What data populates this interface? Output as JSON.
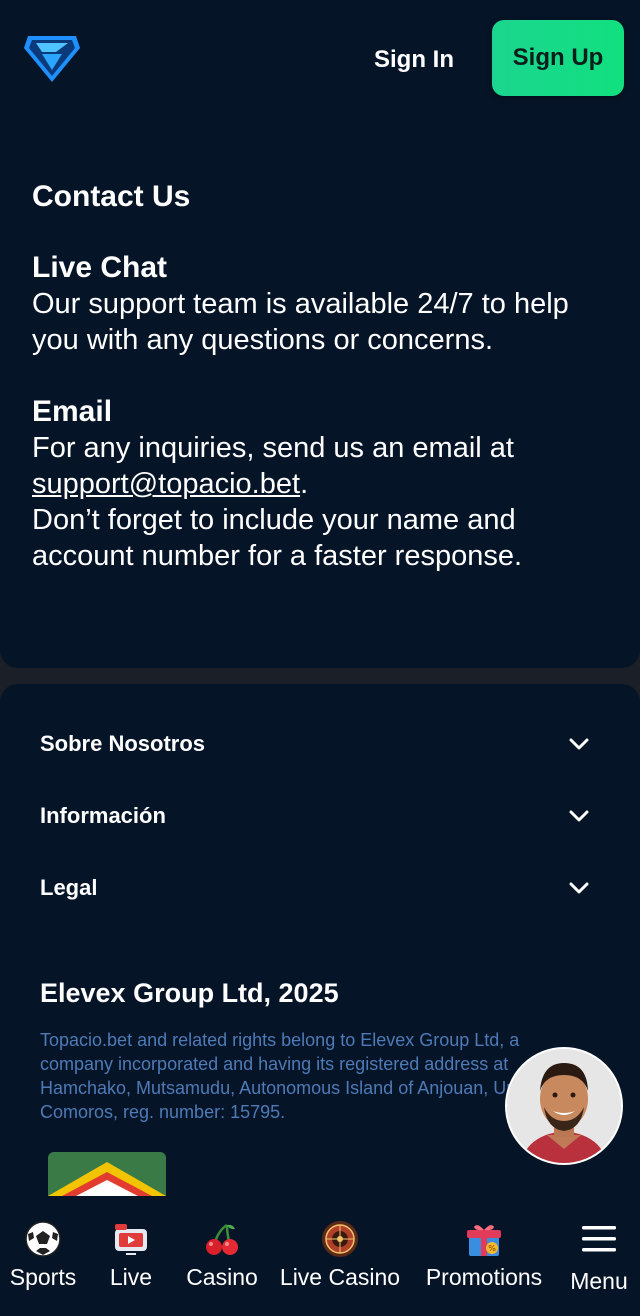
{
  "header": {
    "logo_icon": "topacio-diamond-logo",
    "signin_label": "Sign In",
    "signup_label": "Sign Up",
    "accent": "#17d98a"
  },
  "contact": {
    "title": "Contact Us",
    "live_chat_title": "Live Chat",
    "live_chat_text": "Our support team is available 24/7 to help you with any questions or concerns.",
    "email_title": "Email",
    "email_text_before": "For any inquiries, send us an email at ",
    "email_address": "support@topacio.bet",
    "email_text_after": ".",
    "email_note": "Don’t forget to include your name and account number for a faster response."
  },
  "footer": {
    "sections": [
      {
        "label": "Sobre Nosotros"
      },
      {
        "label": "Información"
      },
      {
        "label": "Legal"
      }
    ],
    "company": "Elevex Group Ltd, 2025",
    "legal_text": "Topacio.bet and related rights belong to Elevex Group Ltd, a company incorporated and having its registered address at Hamchako, Mutsamudu, Autonomous Island of Anjouan, Union of Comoros, reg. number: 15795."
  },
  "support_avatar": "support-agent-avatar",
  "bottom_nav": {
    "items": [
      {
        "label": "Sports",
        "icon": "soccer-ball-icon"
      },
      {
        "label": "Live",
        "icon": "live-tv-icon"
      },
      {
        "label": "Casino",
        "icon": "cherries-icon"
      },
      {
        "label": "Live Casino",
        "icon": "roulette-icon"
      },
      {
        "label": "Promotions",
        "icon": "gift-icon"
      },
      {
        "label": "Menu",
        "icon": "hamburger-menu-icon"
      }
    ]
  }
}
